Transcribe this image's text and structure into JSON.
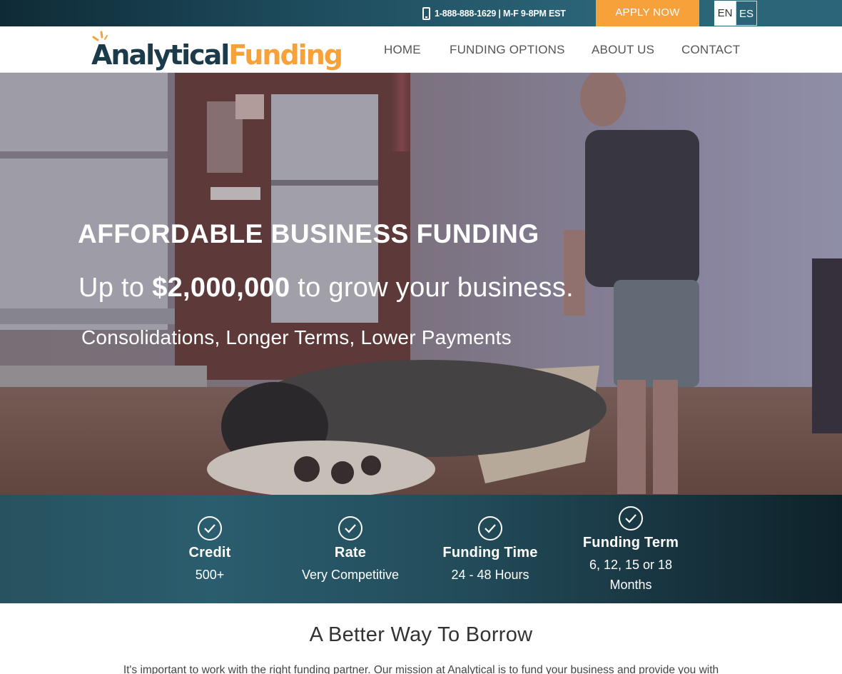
{
  "topbar": {
    "phone_icon": "mobile-phone-icon",
    "phone_text": "1-888-888-1629 | M-F 9-8PM EST",
    "apply_label": "APPLY NOW",
    "languages": [
      "EN",
      "ES"
    ],
    "accent": "#f7a13a"
  },
  "header": {
    "logo_part1": "Analytical",
    "logo_part2": "Funding",
    "nav": [
      "HOME",
      "FUNDING OPTIONS",
      "ABOUT US",
      "CONTACT"
    ]
  },
  "hero": {
    "title": "AFFORDABLE BUSINESS FUNDING",
    "sub_prefix": "Up to",
    "sub_amount": "$2,000,000",
    "sub_suffix": "to grow your business.",
    "sub2": "Consolidations, Longer Terms, Lower Payments"
  },
  "features": [
    {
      "icon": "check-circle-icon",
      "label": "Credit",
      "value": "500+"
    },
    {
      "icon": "check-circle-icon",
      "label": "Rate",
      "value": "Very Competitive"
    },
    {
      "icon": "check-circle-icon",
      "label": "Funding Time",
      "value": "24 - 48 Hours"
    },
    {
      "icon": "check-circle-icon",
      "label": "Funding Term",
      "value_line1": "6, 12, 15 or 18",
      "value_line2": "Months"
    }
  ],
  "content": {
    "title": "A Better Way To Borrow",
    "intro": "It's important to work with the right funding partner. Our mission at Analytical is to fund your business and provide you with"
  }
}
